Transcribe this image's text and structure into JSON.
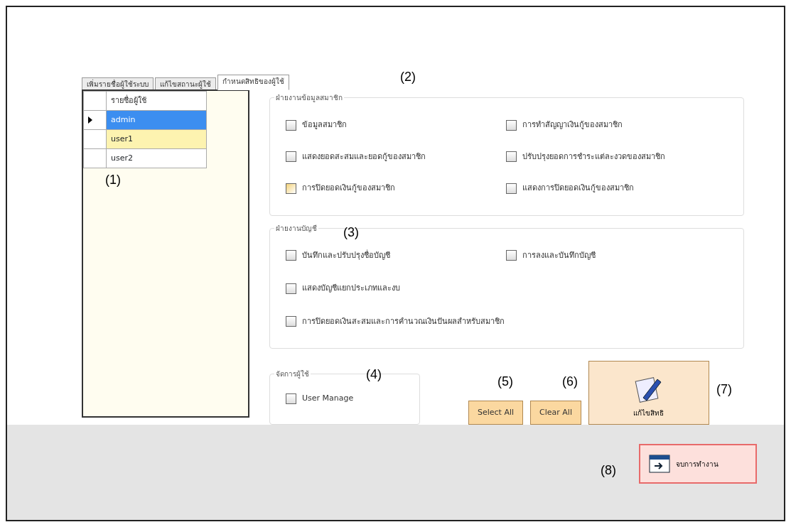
{
  "tabs": [
    {
      "label": "เพิ่มรายชื่อผู้ใช้ระบบ",
      "selected": false
    },
    {
      "label": "แก้ไขสถานะผู้ใช้",
      "selected": false
    },
    {
      "label": "กำหนดสิทธิของผู้ใช้",
      "selected": true
    }
  ],
  "user_grid": {
    "column": "รายชื่อผู้ใช้",
    "rows": [
      {
        "name": "admin",
        "selected": true,
        "highlighted": false
      },
      {
        "name": "user1",
        "selected": false,
        "highlighted": true
      },
      {
        "name": "user2",
        "selected": false,
        "highlighted": false
      }
    ]
  },
  "groups": [
    {
      "title": "ฝ่ายงานข้อมูลสมาชิก",
      "rows": [
        [
          {
            "label": "ข้อมูลสมาชิก",
            "checked": false,
            "hovered": false
          },
          {
            "label": "การทำสัญญาเงินกู้ของสมาชิก",
            "checked": false,
            "hovered": false
          }
        ],
        [
          {
            "label": "แสดงยอดสะสมและยอดกู้ของสมาชิก",
            "checked": false,
            "hovered": false
          },
          {
            "label": "ปรับปรุงยอดการชำระแต่ละงวดของสมาชิก",
            "checked": false,
            "hovered": false
          }
        ],
        [
          {
            "label": "การปิดยอดเงินกู้ของสมาชิก",
            "checked": false,
            "hovered": true
          },
          {
            "label": "แสดงการปิดยอดเงินกู้ของสมาชิก",
            "checked": false,
            "hovered": false
          }
        ]
      ]
    },
    {
      "title": "ฝ่ายงานบัญชี",
      "rows": [
        [
          {
            "label": "บันทึกและปรับปรุงชื่อบัญชี",
            "checked": false,
            "hovered": false
          },
          {
            "label": "การลงและบันทึกบัญชี",
            "checked": false,
            "hovered": false
          }
        ],
        [
          {
            "label": "แสดงบัญชีแยกประเภทและงบ",
            "checked": false,
            "hovered": false
          }
        ],
        [
          {
            "label": "การปิดยอดเงินสะสมและการคำนวณเงินปันผลสำหรับสมาชิก",
            "checked": false,
            "hovered": false
          }
        ]
      ]
    }
  ],
  "user_manage": {
    "title": "จัดการผู้ใช้",
    "item": {
      "label": "User Manage",
      "checked": false,
      "hovered": false
    }
  },
  "buttons": {
    "select_all": "Select All",
    "clear_all": "Clear All",
    "edit_rights": "แก้ไขสิทธิ",
    "exit": "จบการทำงาน"
  },
  "annotations": [
    "(1)",
    "(2)",
    "(3)",
    "(4)",
    "(5)",
    "(6)",
    "(7)",
    "(8)"
  ]
}
